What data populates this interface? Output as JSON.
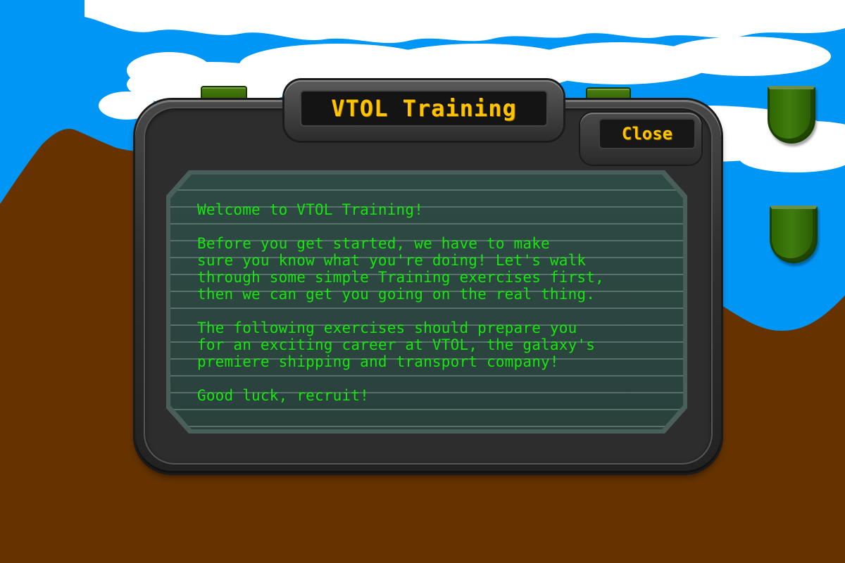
{
  "dialog": {
    "title": "VTOL Training",
    "close_label": "Close",
    "paragraphs": [
      "Welcome to VTOL Training!",
      "Before you get started, we have to make\nsure you know what you're doing! Let's walk\nthrough some simple Training exercises first,\nthen we can get you going on the real thing.",
      "The following exercises should prepare you\nfor an exciting career at VTOL, the galaxy's\npremiere shipping and transport company!",
      "Good luck, recruit!"
    ]
  },
  "colors": {
    "sky": "#0096f5",
    "ground": "#663300",
    "title_text": "#ffc400",
    "message_text": "#17e60d",
    "side_button_green": "#336600"
  },
  "side_buttons": [
    {
      "name": "side-button-top"
    },
    {
      "name": "side-button-bottom"
    }
  ]
}
